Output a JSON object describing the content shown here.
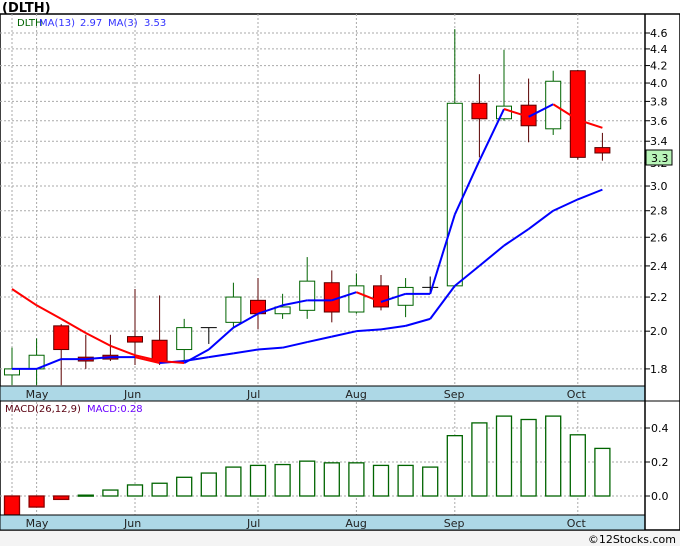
{
  "title": "(DLTH)",
  "legend": {
    "symbol": "DLTH",
    "ma13_label": "MA(13)",
    "ma13_value": "2.97",
    "ma3_label": "MA(3)",
    "ma3_value": "3.53"
  },
  "macd_legend": {
    "label": "MACD(26,12,9)",
    "value_label": "MACD:0.28"
  },
  "last_price_badge": "3.3",
  "footer": "©12Stocks.com",
  "colors": {
    "up": "#006400",
    "down": "#ff0000",
    "ma_rising": "#0000ff",
    "ma_falling": "#ff0000",
    "axis_band": "#add8e6",
    "price_badge": "#b8f5b8"
  },
  "chart_data": [
    {
      "type": "candlestick",
      "scale": "log",
      "ylim": [
        1.7,
        4.7
      ],
      "yticks": [
        "1.8",
        "2.0",
        "2.2",
        "2.4",
        "2.6",
        "2.8",
        "3.0",
        "3.2",
        "3.4",
        "3.6",
        "3.8",
        "4.0",
        "4.2",
        "4.4",
        "4.6"
      ],
      "month_labels": [
        {
          "label": "May",
          "index": 1
        },
        {
          "label": "Jun",
          "index": 5
        },
        {
          "label": "Jul",
          "index": 10
        },
        {
          "label": "Aug",
          "index": 14
        },
        {
          "label": "Sep",
          "index": 18
        },
        {
          "label": "Oct",
          "index": 23
        }
      ],
      "grid": true,
      "ohlc": [
        [
          1.77,
          1.91,
          1.72,
          1.8
        ],
        [
          1.8,
          1.96,
          1.72,
          1.87
        ],
        [
          2.03,
          2.04,
          1.72,
          1.9
        ],
        [
          1.86,
          1.98,
          1.8,
          1.84
        ],
        [
          1.87,
          1.98,
          1.84,
          1.85
        ],
        [
          1.97,
          2.25,
          1.82,
          1.94
        ],
        [
          1.95,
          2.21,
          1.82,
          1.84
        ],
        [
          1.9,
          2.07,
          1.84,
          2.02
        ],
        [
          2.02,
          2.02,
          1.93,
          2.02
        ],
        [
          2.05,
          2.29,
          2.02,
          2.2
        ],
        [
          2.18,
          2.32,
          2.01,
          2.1
        ],
        [
          2.1,
          2.22,
          2.07,
          2.14
        ],
        [
          2.12,
          2.46,
          2.07,
          2.3
        ],
        [
          2.29,
          2.37,
          2.05,
          2.11
        ],
        [
          2.11,
          2.35,
          2.1,
          2.27
        ],
        [
          2.27,
          2.34,
          2.12,
          2.14
        ],
        [
          2.15,
          2.32,
          2.08,
          2.26
        ],
        [
          2.26,
          2.33,
          2.22,
          2.26
        ],
        [
          2.27,
          4.65,
          2.27,
          3.78
        ],
        [
          3.78,
          4.1,
          3.25,
          3.62
        ],
        [
          3.62,
          4.39,
          3.6,
          3.75
        ],
        [
          3.76,
          4.05,
          3.39,
          3.55
        ],
        [
          3.52,
          4.14,
          3.46,
          4.02
        ],
        [
          4.14,
          4.15,
          3.23,
          3.25
        ],
        [
          3.34,
          3.48,
          3.22,
          3.29
        ]
      ],
      "series": [
        {
          "name": "MA(13)",
          "values": [
            1.8,
            1.8,
            1.85,
            1.85,
            1.86,
            1.86,
            1.83,
            1.84,
            1.86,
            1.88,
            1.9,
            1.91,
            1.94,
            1.97,
            2.0,
            2.01,
            2.03,
            2.07,
            2.27,
            2.4,
            2.54,
            2.66,
            2.8,
            2.89,
            2.97
          ]
        },
        {
          "name": "MA(3)",
          "values": [
            2.25,
            2.15,
            2.07,
            1.99,
            1.92,
            1.87,
            1.84,
            1.83,
            1.9,
            2.02,
            2.1,
            2.15,
            2.18,
            2.18,
            2.23,
            2.17,
            2.22,
            2.22,
            2.77,
            3.22,
            3.72,
            3.64,
            3.77,
            3.61,
            3.53
          ]
        }
      ]
    },
    {
      "type": "bar",
      "ylim": [
        -0.12,
        0.55
      ],
      "yticks": [
        "0.0",
        "0.2",
        "0.4"
      ],
      "values": [
        -0.12,
        -0.065,
        -0.02,
        0.005,
        0.035,
        0.065,
        0.075,
        0.11,
        0.135,
        0.17,
        0.18,
        0.185,
        0.205,
        0.195,
        0.195,
        0.18,
        0.18,
        0.17,
        0.355,
        0.43,
        0.47,
        0.45,
        0.47,
        0.36,
        0.28
      ]
    }
  ]
}
